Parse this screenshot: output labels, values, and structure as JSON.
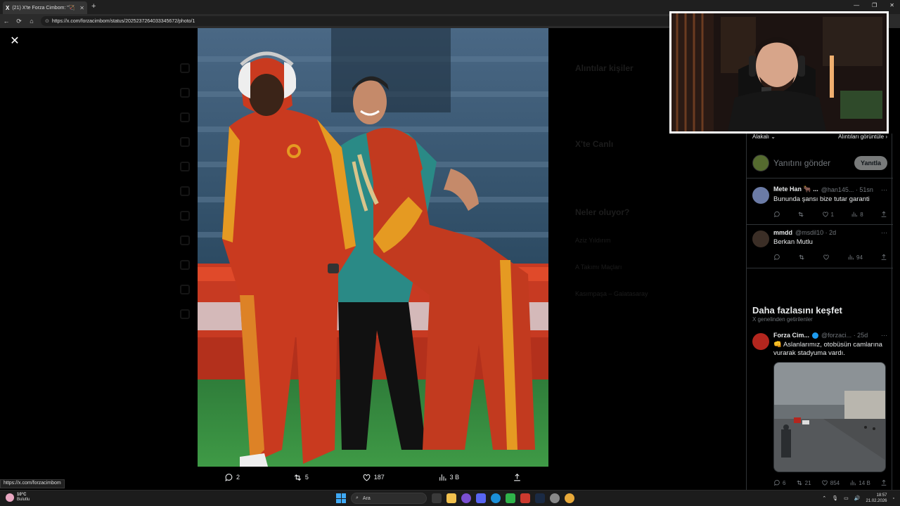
{
  "browser": {
    "tab_title": "(21) X'te Forza Cimbom: \"🏹 Boş",
    "tab_logo": "X",
    "new_tab": "+",
    "url": "https://x.com/forzacimbom/status/2025237264033345672/photo/1",
    "window_controls": [
      "—",
      "❐",
      "✕"
    ]
  },
  "viewer": {
    "close": "✕",
    "actions": {
      "replies": "2",
      "reposts": "5",
      "likes": "187",
      "views": "3 B"
    }
  },
  "background_page": {
    "who_to_follow": "Alıntılar kişiler",
    "x_live": "X'te Canlı",
    "whats_happening": "Neler oluyor?",
    "trend_1": "Aziz Yıldırım",
    "trend_2": "A Takımı Maçları",
    "trend_3": "Kasımpaşa – Galatasaray"
  },
  "panel": {
    "sort_label": "Alakalı",
    "quotes_label": "Alıntıları görüntüle",
    "reply_placeholder": "Yanıtını gönder",
    "reply_button": "Yanıtla",
    "tweets": [
      {
        "name": "Mete Han 🐂 ...",
        "handle": "@han145...",
        "time": "· 51sn",
        "text": "Bunundа şansı bize tutar garanti",
        "likes": "1",
        "views": "8"
      },
      {
        "name": "mmdd",
        "handle": "@msdil10",
        "time": "· 2d",
        "text": "Berkan Mutlu",
        "likes": "",
        "views": "94"
      }
    ],
    "discover_title": "Daha fazlasını keşfet",
    "discover_subtitle": "X genelinden getirilenler",
    "featured": {
      "name": "Forza Cim...",
      "handle": "@forzaci...",
      "time": "· 25d",
      "text": "👊 Aslanlarımız, otobüsün camlarına vurarak stadyuma vardı.",
      "replies": "6",
      "reposts": "21",
      "likes": "854",
      "views": "14 B"
    }
  },
  "statusbar": {
    "link": "https://x.com/forzacimbom"
  },
  "taskbar": {
    "weather_temp": "10°C",
    "weather_desc": "Bulutlu",
    "search_placeholder": "Ara",
    "time": "18:57",
    "date": "21.02.2026"
  }
}
